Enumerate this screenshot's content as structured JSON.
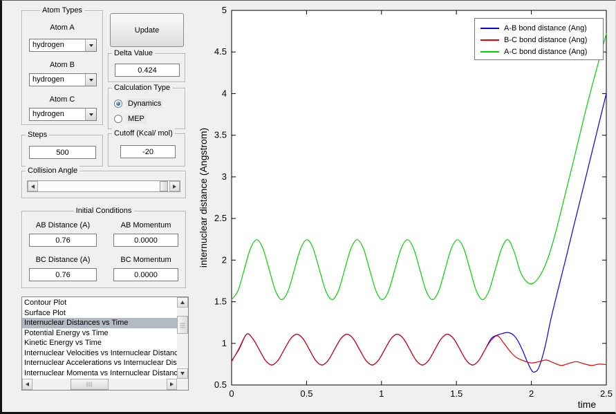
{
  "panel": {
    "atom_types": {
      "title": "Atom Types",
      "fields": [
        {
          "label": "Atom A",
          "value": "hydrogen"
        },
        {
          "label": "Atom B",
          "value": "hydrogen"
        },
        {
          "label": "Atom C",
          "value": "hydrogen"
        }
      ]
    },
    "update_button": "Update",
    "delta": {
      "title": "Delta Value",
      "value": "0.424"
    },
    "calculation": {
      "title": "Calculation Type",
      "options": [
        {
          "label": "Dynamics",
          "selected": true
        },
        {
          "label": "MEP",
          "selected": false
        }
      ]
    },
    "steps": {
      "title": "Steps",
      "value": "500"
    },
    "cutoff": {
      "title": "Cutoff (Kcal/ mol)",
      "value": "-20"
    },
    "collision_angle": {
      "title": "Collision Angle"
    },
    "initial_conditions": {
      "title": "Initial Conditions",
      "fields": [
        {
          "label": "AB Distance (A)",
          "value": "0.76"
        },
        {
          "label": "AB Momentum",
          "value": "0.0000"
        },
        {
          "label": "BC Distance (A)",
          "value": "0.76"
        },
        {
          "label": "BC Momentum",
          "value": "0.0000"
        }
      ]
    },
    "plot_list": {
      "items": [
        "Contour Plot",
        "Surface Plot",
        "Internuclear Distances vs Time",
        "Potential Energy vs Time",
        "Kinetic Energy vs Time",
        "Internuclear Velocities vs Internuclear Distance",
        "Internuclear Accelerations vs Internuclear Dista",
        "Internuclear Momenta vs Internuclear Distance"
      ],
      "selected_index": 2
    }
  },
  "chart_data": {
    "type": "line",
    "title": "",
    "xlabel": "time",
    "ylabel": "internuclear distance (Angstrom)",
    "xlim": [
      0,
      2.5
    ],
    "ylim": [
      0.5,
      5
    ],
    "xticks": [
      0,
      0.5,
      1,
      1.5,
      2,
      2.5
    ],
    "yticks": [
      0.5,
      1,
      1.5,
      2,
      2.5,
      3,
      3.5,
      4,
      4.5,
      5
    ],
    "grid": false,
    "legend_position": "top-right",
    "series": [
      {
        "name": "A-B bond distance (Ang)",
        "color": "#0000ee",
        "points": [
          [
            0,
            0.79
          ],
          [
            0.05,
            0.93
          ],
          [
            0.1,
            1.11
          ],
          [
            0.142,
            1.055
          ],
          [
            0.184,
            0.925
          ],
          [
            0.226,
            0.795
          ],
          [
            0.268,
            0.74
          ],
          [
            0.309,
            0.795
          ],
          [
            0.351,
            0.925
          ],
          [
            0.393,
            1.055
          ],
          [
            0.435,
            1.11
          ],
          [
            0.477,
            1.055
          ],
          [
            0.519,
            0.925
          ],
          [
            0.561,
            0.795
          ],
          [
            0.603,
            0.74
          ],
          [
            0.644,
            0.795
          ],
          [
            0.686,
            0.925
          ],
          [
            0.728,
            1.055
          ],
          [
            0.77,
            1.11
          ],
          [
            0.812,
            1.055
          ],
          [
            0.854,
            0.925
          ],
          [
            0.896,
            0.795
          ],
          [
            0.938,
            0.74
          ],
          [
            0.979,
            0.795
          ],
          [
            1.021,
            0.925
          ],
          [
            1.063,
            1.055
          ],
          [
            1.105,
            1.11
          ],
          [
            1.147,
            1.055
          ],
          [
            1.189,
            0.925
          ],
          [
            1.231,
            0.795
          ],
          [
            1.273,
            0.74
          ],
          [
            1.314,
            0.795
          ],
          [
            1.356,
            0.925
          ],
          [
            1.398,
            1.055
          ],
          [
            1.44,
            1.11
          ],
          [
            1.482,
            1.055
          ],
          [
            1.524,
            0.925
          ],
          [
            1.566,
            0.795
          ],
          [
            1.608,
            0.74
          ],
          [
            1.649,
            0.795
          ],
          [
            1.691,
            0.925
          ],
          [
            1.733,
            1.06
          ],
          [
            1.775,
            1.1
          ],
          [
            1.81,
            1.12
          ],
          [
            1.845,
            1.13
          ],
          [
            1.88,
            1.1
          ],
          [
            1.91,
            1.03
          ],
          [
            1.94,
            0.92
          ],
          [
            1.97,
            0.79
          ],
          [
            2.0,
            0.68
          ],
          [
            2.02,
            0.655
          ],
          [
            2.05,
            0.71
          ],
          [
            2.09,
            0.95
          ],
          [
            2.13,
            1.29
          ],
          [
            2.18,
            1.66
          ],
          [
            2.23,
            2.02
          ],
          [
            2.28,
            2.39
          ],
          [
            2.33,
            2.75
          ],
          [
            2.38,
            3.12
          ],
          [
            2.44,
            3.56
          ],
          [
            2.5,
            4.0
          ]
        ]
      },
      {
        "name": "B-C bond distance (Ang)",
        "color": "#e60000",
        "points": [
          [
            0,
            0.78
          ],
          [
            0.05,
            0.94
          ],
          [
            0.1,
            1.11
          ],
          [
            0.142,
            1.055
          ],
          [
            0.184,
            0.925
          ],
          [
            0.226,
            0.795
          ],
          [
            0.268,
            0.74
          ],
          [
            0.309,
            0.795
          ],
          [
            0.351,
            0.925
          ],
          [
            0.393,
            1.055
          ],
          [
            0.435,
            1.11
          ],
          [
            0.477,
            1.055
          ],
          [
            0.519,
            0.925
          ],
          [
            0.561,
            0.795
          ],
          [
            0.603,
            0.74
          ],
          [
            0.644,
            0.795
          ],
          [
            0.686,
            0.925
          ],
          [
            0.728,
            1.055
          ],
          [
            0.77,
            1.11
          ],
          [
            0.812,
            1.055
          ],
          [
            0.854,
            0.925
          ],
          [
            0.896,
            0.795
          ],
          [
            0.938,
            0.74
          ],
          [
            0.979,
            0.795
          ],
          [
            1.021,
            0.925
          ],
          [
            1.063,
            1.055
          ],
          [
            1.105,
            1.11
          ],
          [
            1.147,
            1.055
          ],
          [
            1.189,
            0.925
          ],
          [
            1.231,
            0.795
          ],
          [
            1.273,
            0.74
          ],
          [
            1.314,
            0.795
          ],
          [
            1.356,
            0.925
          ],
          [
            1.398,
            1.055
          ],
          [
            1.44,
            1.11
          ],
          [
            1.482,
            1.055
          ],
          [
            1.524,
            0.925
          ],
          [
            1.566,
            0.795
          ],
          [
            1.608,
            0.74
          ],
          [
            1.649,
            0.795
          ],
          [
            1.691,
            0.925
          ],
          [
            1.733,
            1.04
          ],
          [
            1.775,
            1.09
          ],
          [
            1.817,
            1.0
          ],
          [
            1.86,
            0.9
          ],
          [
            1.9,
            0.83
          ],
          [
            1.95,
            0.79
          ],
          [
            2.0,
            0.765
          ],
          [
            2.05,
            0.78
          ],
          [
            2.1,
            0.8
          ],
          [
            2.15,
            0.765
          ],
          [
            2.2,
            0.735
          ],
          [
            2.25,
            0.76
          ],
          [
            2.3,
            0.78
          ],
          [
            2.35,
            0.755
          ],
          [
            2.4,
            0.735
          ],
          [
            2.45,
            0.75
          ],
          [
            2.5,
            0.745
          ]
        ]
      },
      {
        "name": "A-C bond distance (Ang)",
        "color": "#00d400",
        "points": [
          [
            0,
            1.525
          ],
          [
            0.042,
            1.63
          ],
          [
            0.084,
            1.885
          ],
          [
            0.126,
            2.14
          ],
          [
            0.168,
            2.245
          ],
          [
            0.209,
            2.14
          ],
          [
            0.251,
            1.885
          ],
          [
            0.293,
            1.63
          ],
          [
            0.335,
            1.525
          ],
          [
            0.377,
            1.63
          ],
          [
            0.419,
            1.885
          ],
          [
            0.461,
            2.14
          ],
          [
            0.503,
            2.245
          ],
          [
            0.544,
            2.14
          ],
          [
            0.586,
            1.885
          ],
          [
            0.628,
            1.63
          ],
          [
            0.67,
            1.525
          ],
          [
            0.712,
            1.63
          ],
          [
            0.754,
            1.885
          ],
          [
            0.796,
            2.14
          ],
          [
            0.838,
            2.245
          ],
          [
            0.879,
            2.14
          ],
          [
            0.921,
            1.885
          ],
          [
            0.963,
            1.63
          ],
          [
            1.005,
            1.525
          ],
          [
            1.047,
            1.63
          ],
          [
            1.089,
            1.885
          ],
          [
            1.131,
            2.14
          ],
          [
            1.173,
            2.245
          ],
          [
            1.214,
            2.14
          ],
          [
            1.256,
            1.885
          ],
          [
            1.298,
            1.63
          ],
          [
            1.34,
            1.525
          ],
          [
            1.382,
            1.63
          ],
          [
            1.424,
            1.885
          ],
          [
            1.466,
            2.14
          ],
          [
            1.508,
            2.245
          ],
          [
            1.549,
            2.14
          ],
          [
            1.591,
            1.885
          ],
          [
            1.633,
            1.63
          ],
          [
            1.675,
            1.525
          ],
          [
            1.717,
            1.63
          ],
          [
            1.759,
            1.885
          ],
          [
            1.801,
            2.14
          ],
          [
            1.843,
            2.245
          ],
          [
            1.885,
            2.1
          ],
          [
            1.926,
            1.86
          ],
          [
            1.968,
            1.74
          ],
          [
            2.01,
            1.72
          ],
          [
            2.06,
            1.82
          ],
          [
            2.11,
            2.02
          ],
          [
            2.16,
            2.32
          ],
          [
            2.22,
            2.75
          ],
          [
            2.29,
            3.26
          ],
          [
            2.36,
            3.78
          ],
          [
            2.43,
            4.26
          ],
          [
            2.5,
            4.72
          ]
        ]
      }
    ]
  }
}
